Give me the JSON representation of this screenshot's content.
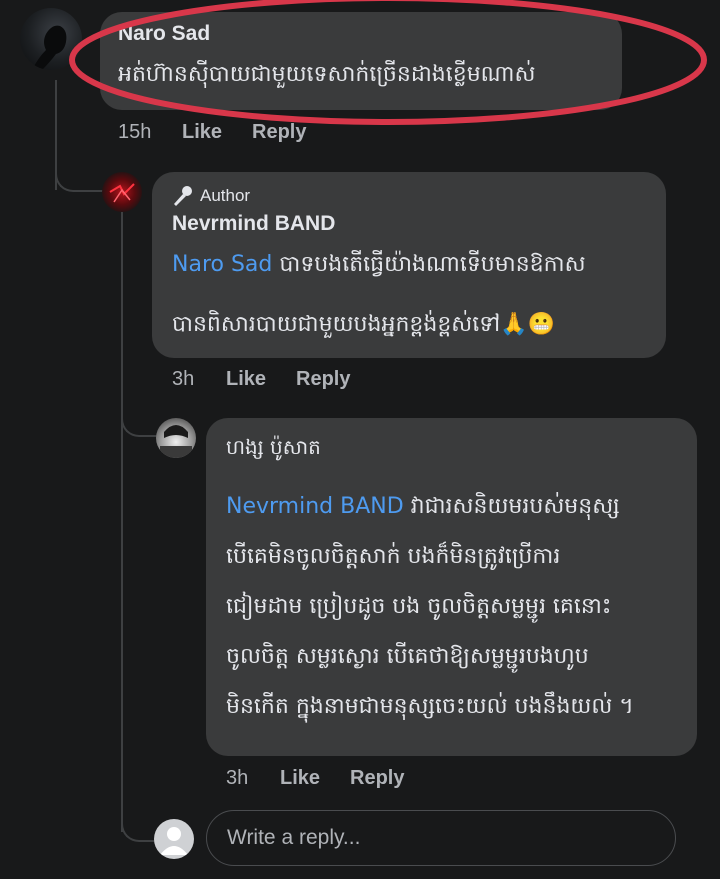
{
  "comment1": {
    "author": "Naro Sad",
    "text": "អត់ហ៊ានសុីបាយជាមួយទេសាក់ច្រើនដាងខ្លើមណាស់",
    "time": "15h",
    "like": "Like",
    "reply": "Reply"
  },
  "comment2": {
    "badge": "Author",
    "author": "Nevrmind BAND",
    "mention": "Naro Sad",
    "line1": "បាទបងតើធ្វើយ៉ាងណាទើបមានឱកាស",
    "line2": "បានពិសារបាយជាមួយបងអ្នកខ្ពង់ខ្ពស់ទៅ🙏😬",
    "time": "3h",
    "like": "Like",
    "reply": "Reply"
  },
  "comment3": {
    "author": "ហង្ស ប៉ូសាត",
    "mention": "Nevrmind BAND",
    "line1": " វាជារសនិយមរបស់មនុស្ស",
    "line2": "បើគេមិនចូលចិត្តសាក់ បងក៏មិនត្រូវប្រើការ",
    "line3": "ជៀមដាម ប្រៀបដូច បង ចូលចិត្តសម្លម្ជូរ គេនោះ",
    "line4": "ចូលចិត្ត សម្លរស្ងោរ បើគេថាឱ្យសម្លម្ជូរបងហូប",
    "line5": "មិនកើត ក្នុងនាមជាមនុស្សចេះយល់ បងនឹងយល់ ។",
    "time": "3h",
    "like": "Like",
    "reply": "Reply"
  },
  "reply_box": {
    "placeholder": "Write a reply..."
  },
  "colors": {
    "highlight_circle": "#d8374a",
    "mention": "#4e9bf0"
  }
}
